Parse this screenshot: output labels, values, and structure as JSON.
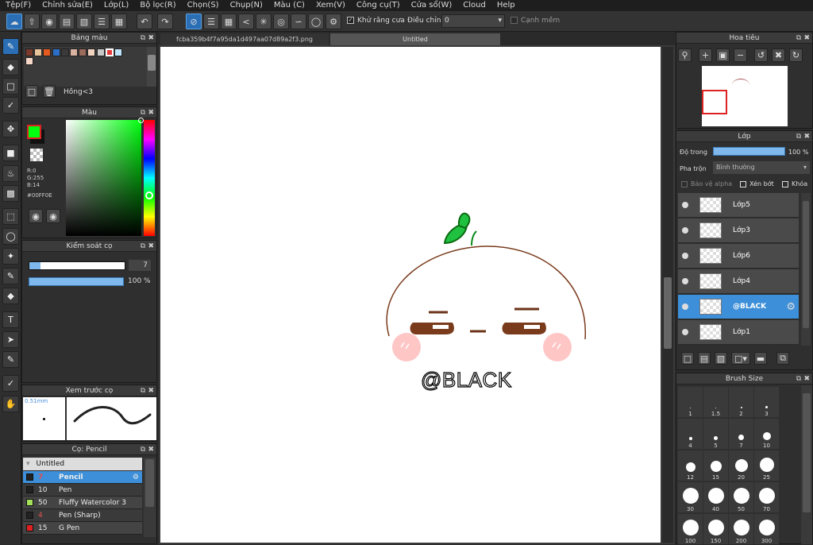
{
  "menu": [
    "Tệp(F)",
    "Chỉnh sửa(E)",
    "Lớp(L)",
    "Bộ lọc(R)",
    "Chọn(S)",
    "Chụp(N)",
    "Màu (C)",
    "Xem(V)",
    "Công cụ(T)",
    "Cửa sổ(W)",
    "Cloud",
    "Help"
  ],
  "toolbar": {
    "antialias_label": "Khử răng cưa",
    "adjust_label": "Điều chỉnh",
    "adjust_value": "0",
    "smooth_label": "Cạnh mềm"
  },
  "tabs": [
    "fcba359b4f7a95da1d497aa07d89a2f3.png",
    "Untitled"
  ],
  "palette": {
    "title": "Bảng màu",
    "name": "Hồng<3",
    "colors": [
      "#7a3b2c",
      "#e8c49a",
      "#e55a1e",
      "#2b6fc9",
      "#3a3a3a",
      "#d9b3a0",
      "#9b6b5b",
      "#f2d3c0",
      "#c9c9c9",
      "#e63b3b",
      "#bfe6ff"
    ]
  },
  "color": {
    "title": "Màu",
    "r": "R:0",
    "g": "G:255",
    "b": "B:14",
    "hex": "#00FF0E",
    "fg": "#00ff0e"
  },
  "brush_control": {
    "title": "Kiểm soát cọ",
    "size": "7",
    "opacity": "100 %"
  },
  "preview": {
    "title": "Xem trước cọ",
    "size": "0.51mm"
  },
  "brush_list": {
    "title": "Cọ: Pencil",
    "folder": "Untitled",
    "items": [
      {
        "num": "7",
        "name": "Pencil",
        "color": "#222222",
        "selected": true
      },
      {
        "num": "10",
        "name": "Pen",
        "color": "#222222",
        "selected": false
      },
      {
        "num": "50",
        "name": "Fluffy Watercolor 3",
        "color": "#a4e05a",
        "selected": false
      },
      {
        "num": "4",
        "name": "Pen (Sharp)",
        "color": "#222222",
        "selected": false
      },
      {
        "num": "15",
        "name": "G Pen",
        "color": "#e02020",
        "selected": false
      }
    ]
  },
  "navigator": {
    "title": "Hoa tiêu"
  },
  "layer": {
    "title": "Lớp",
    "opacity_label": "Độ trong",
    "opacity_value": "100 %",
    "opacity": 1.0,
    "blend_label": "Pha trộn",
    "blend_value": "Bình thường",
    "protect_alpha": "Bảo vệ alpha",
    "clip": "Xén bớt",
    "lock": "Khóa",
    "items": [
      {
        "name": "Lớp5",
        "selected": false
      },
      {
        "name": "Lớp3",
        "selected": false
      },
      {
        "name": "Lớp6",
        "selected": false
      },
      {
        "name": "Lớp4",
        "selected": false
      },
      {
        "name": "@BLACK",
        "selected": true
      },
      {
        "name": "Lớp1",
        "selected": false
      }
    ]
  },
  "brush_size": {
    "title": "Brush Size",
    "sizes": [
      "1",
      "1.5",
      "2",
      "3",
      "4",
      "5",
      "7",
      "10",
      "12",
      "15",
      "20",
      "25",
      "30",
      "40",
      "50",
      "70",
      "100",
      "150",
      "200",
      "300"
    ]
  },
  "canvas": {
    "text": "@BLACK"
  }
}
